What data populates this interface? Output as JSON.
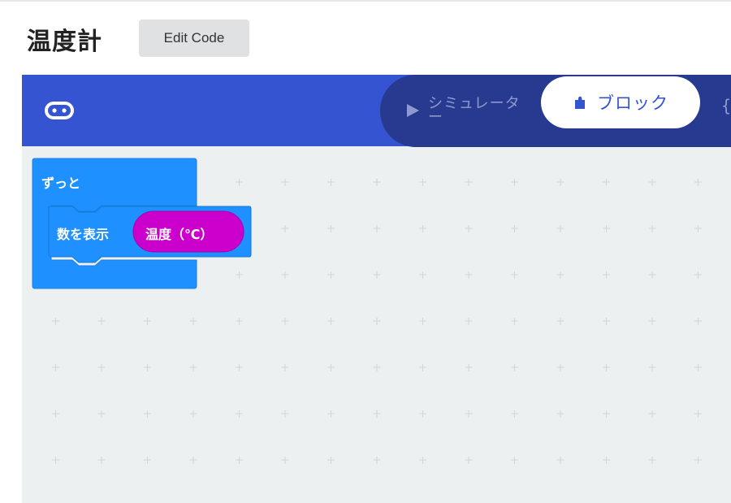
{
  "page": {
    "title": "温度計"
  },
  "header": {
    "edit_code_label": "Edit Code"
  },
  "toolbar": {
    "icon": "microbit-logo-icon",
    "tabs": [
      {
        "label": "シミュレーター",
        "icon": "play-icon",
        "active": false
      },
      {
        "label": "ブロック",
        "icon": "puzzle-piece-icon",
        "active": true
      },
      {
        "label": "{",
        "icon": "code-braces-icon",
        "active": false
      }
    ]
  },
  "workspace": {
    "blocks": {
      "forever": {
        "label": "ずっと",
        "color": "#1e90ff"
      },
      "show_number": {
        "label": "数を表示",
        "color": "#1e90ff"
      },
      "temperature": {
        "label": "温度（℃）",
        "color": "#cc00cc"
      }
    }
  },
  "colors": {
    "toolbar": "#3454d1",
    "toolbar_pill": "#273a8f",
    "workspace_bg": "#ecf0f1",
    "basic_block": "#1e90ff",
    "input_block": "#cc00cc"
  }
}
